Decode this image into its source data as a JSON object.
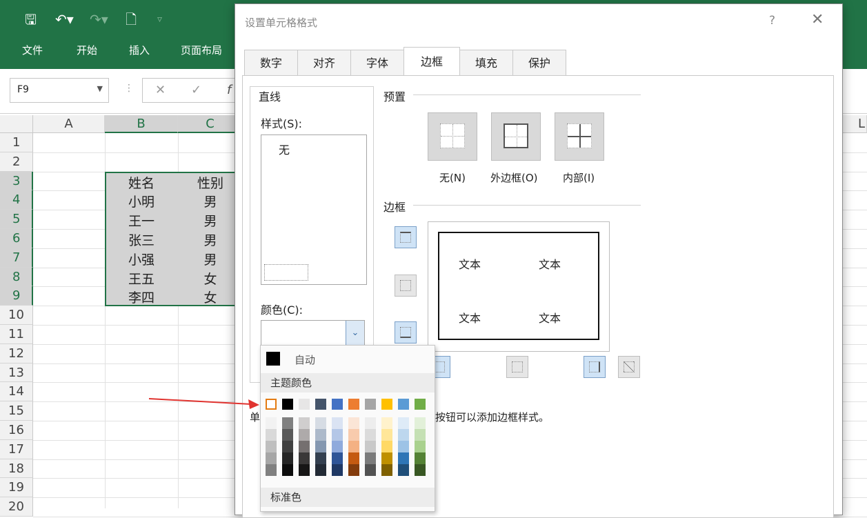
{
  "quick_access": {
    "save_icon": "save-icon",
    "undo_icon": "undo-icon",
    "redo_icon": "redo-icon",
    "new_icon": "new-doc-icon",
    "customize_icon": "customize-icon"
  },
  "ribbon_tabs": [
    "文件",
    "开始",
    "插入",
    "页面布局"
  ],
  "name_box": {
    "value": "F9"
  },
  "columns": [
    "A",
    "B",
    "C"
  ],
  "right_edge_column": "L",
  "rows": [
    "1",
    "2",
    "3",
    "4",
    "5",
    "6",
    "7",
    "8",
    "9",
    "10",
    "11",
    "12",
    "13",
    "14",
    "15",
    "16",
    "17",
    "18",
    "19",
    "20"
  ],
  "table": {
    "header": [
      "姓名",
      "性别"
    ],
    "rows": [
      [
        "小明",
        "男"
      ],
      [
        "王一",
        "男"
      ],
      [
        "张三",
        "男"
      ],
      [
        "小强",
        "男"
      ],
      [
        "王五",
        "女"
      ],
      [
        "李四",
        "女"
      ]
    ]
  },
  "dialog": {
    "title": "设置单元格格式",
    "help": "?",
    "tabs": [
      "数字",
      "对齐",
      "字体",
      "边框",
      "填充",
      "保护"
    ],
    "active_tab": "边框",
    "line_group": "直线",
    "style_label": "样式(S):",
    "style_none": "无",
    "color_label": "颜色(C):",
    "presets_group": "预置",
    "presets": [
      "无(N)",
      "外边框(O)",
      "内部(I)"
    ],
    "border_group": "边框",
    "preview_text": "文本",
    "hint_prefix": "单",
    "hint_text": "按钮可以添加边框样式。"
  },
  "palette": {
    "auto_label": "自动",
    "theme_label": "主题颜色",
    "standard_label": "标准色",
    "theme_top": [
      "#ffffff",
      "#000000",
      "#e7e6e6",
      "#44546a",
      "#4472c4",
      "#ed7d31",
      "#a5a5a5",
      "#ffc000",
      "#5b9bd5",
      "#70ad47"
    ],
    "theme_shades": [
      [
        "#f2f2f2",
        "#d9d9d9",
        "#bfbfbf",
        "#a6a6a6",
        "#808080"
      ],
      [
        "#808080",
        "#595959",
        "#404040",
        "#262626",
        "#0d0d0d"
      ],
      [
        "#d0cece",
        "#aeaaaa",
        "#757070",
        "#3a3838",
        "#171616"
      ],
      [
        "#d6dce4",
        "#acb9ca",
        "#8497b0",
        "#333f4f",
        "#222a35"
      ],
      [
        "#dae3f3",
        "#b4c7e7",
        "#8faadc",
        "#2f5597",
        "#1f3864"
      ],
      [
        "#fbe5d6",
        "#f8cbad",
        "#f4b183",
        "#c55a11",
        "#843c0c"
      ],
      [
        "#ededed",
        "#dbdbdb",
        "#c9c9c9",
        "#7b7b7b",
        "#525252"
      ],
      [
        "#fff2cc",
        "#ffe699",
        "#ffd966",
        "#bf9000",
        "#7f6000"
      ],
      [
        "#deebf7",
        "#bdd7ee",
        "#9dc3e6",
        "#2e75b6",
        "#1f4e79"
      ],
      [
        "#e2f0d9",
        "#c5e0b4",
        "#a9d18e",
        "#548235",
        "#385723"
      ]
    ]
  },
  "colors": {
    "excel_green": "#217346",
    "annotation_arrow": "#e0332f"
  }
}
